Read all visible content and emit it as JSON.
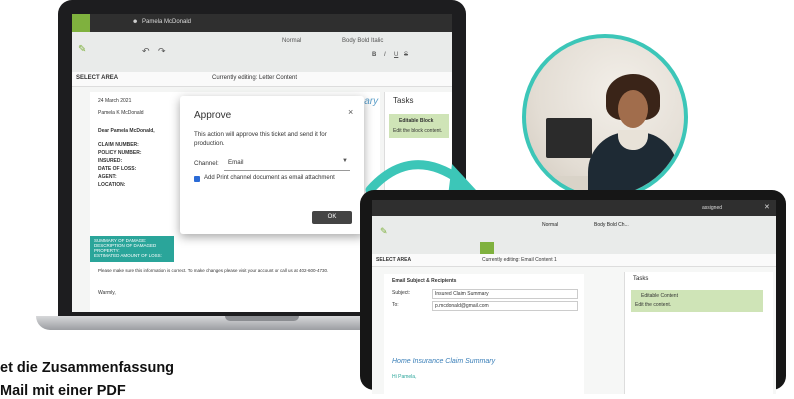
{
  "laptop": {
    "topbar_user": "Pamela McDonald",
    "style_normal": "Normal",
    "style_bold": "Body Bold Italic",
    "select_area": "SELECT AREA",
    "currently_editing": "Currently editing: Letter Content",
    "doc_date": "24 March 2021",
    "doc_address": "Pamela K McDonald",
    "doc_dear": "Dear Pamela McDonald,",
    "doc_labels": [
      "CLAIM NUMBER:",
      "POLICY NUMBER:",
      "INSURED:",
      "DATE OF LOSS:",
      "AGENT:",
      "LOCATION:"
    ],
    "teal_lines": [
      "SUMMARY OF DAMAGE:",
      "DESCRIPTION OF DAMAGED PROPERTY:",
      "ESTIMATED AMOUNT OF LOSS:"
    ],
    "doc_footer": "Please make sure this information is correct. To make changes please visit your account or call us at 402-600-4730.",
    "doc_sign": "Warmly,",
    "summary_ghost": "ummary",
    "tasks_title": "Tasks",
    "task_card_title": "Editable Block",
    "task_card_body": "Edit the block content."
  },
  "modal": {
    "title": "Approve",
    "close": "×",
    "text": "This action will approve this ticket and send it for production.",
    "channel_label": "Channel:",
    "channel_value": "Email",
    "checkbox_label": "Add Print channel document as email attachment",
    "ok_label": "OK"
  },
  "tablet": {
    "topbar_right": "assigned",
    "style_normal": "Normal",
    "style_bold": "Body Bold Ch...",
    "select_area": "SELECT AREA",
    "currently_editing": "Currently editing: Email Content 1",
    "section": "Email Subject & Recipients",
    "subject_label": "Subject:",
    "subject_value": "Insured Claim Summary",
    "to_label": "To:",
    "to_value": "p.mcdonald@gmail.com",
    "form_title": "Home Insurance Claim Summary",
    "form_line": "Hi Pamela,",
    "tasks_title": "Tasks",
    "task_card_title": "Editable Content",
    "task_card_body": "Edit the content."
  },
  "caption": {
    "line1": "et die Zusammenfassung",
    "line2": "Mail mit einer PDF"
  },
  "colors": {
    "accent_teal": "#3cc6b8",
    "brand_green": "#7fb13e",
    "task_card": "#cfe4b7"
  }
}
